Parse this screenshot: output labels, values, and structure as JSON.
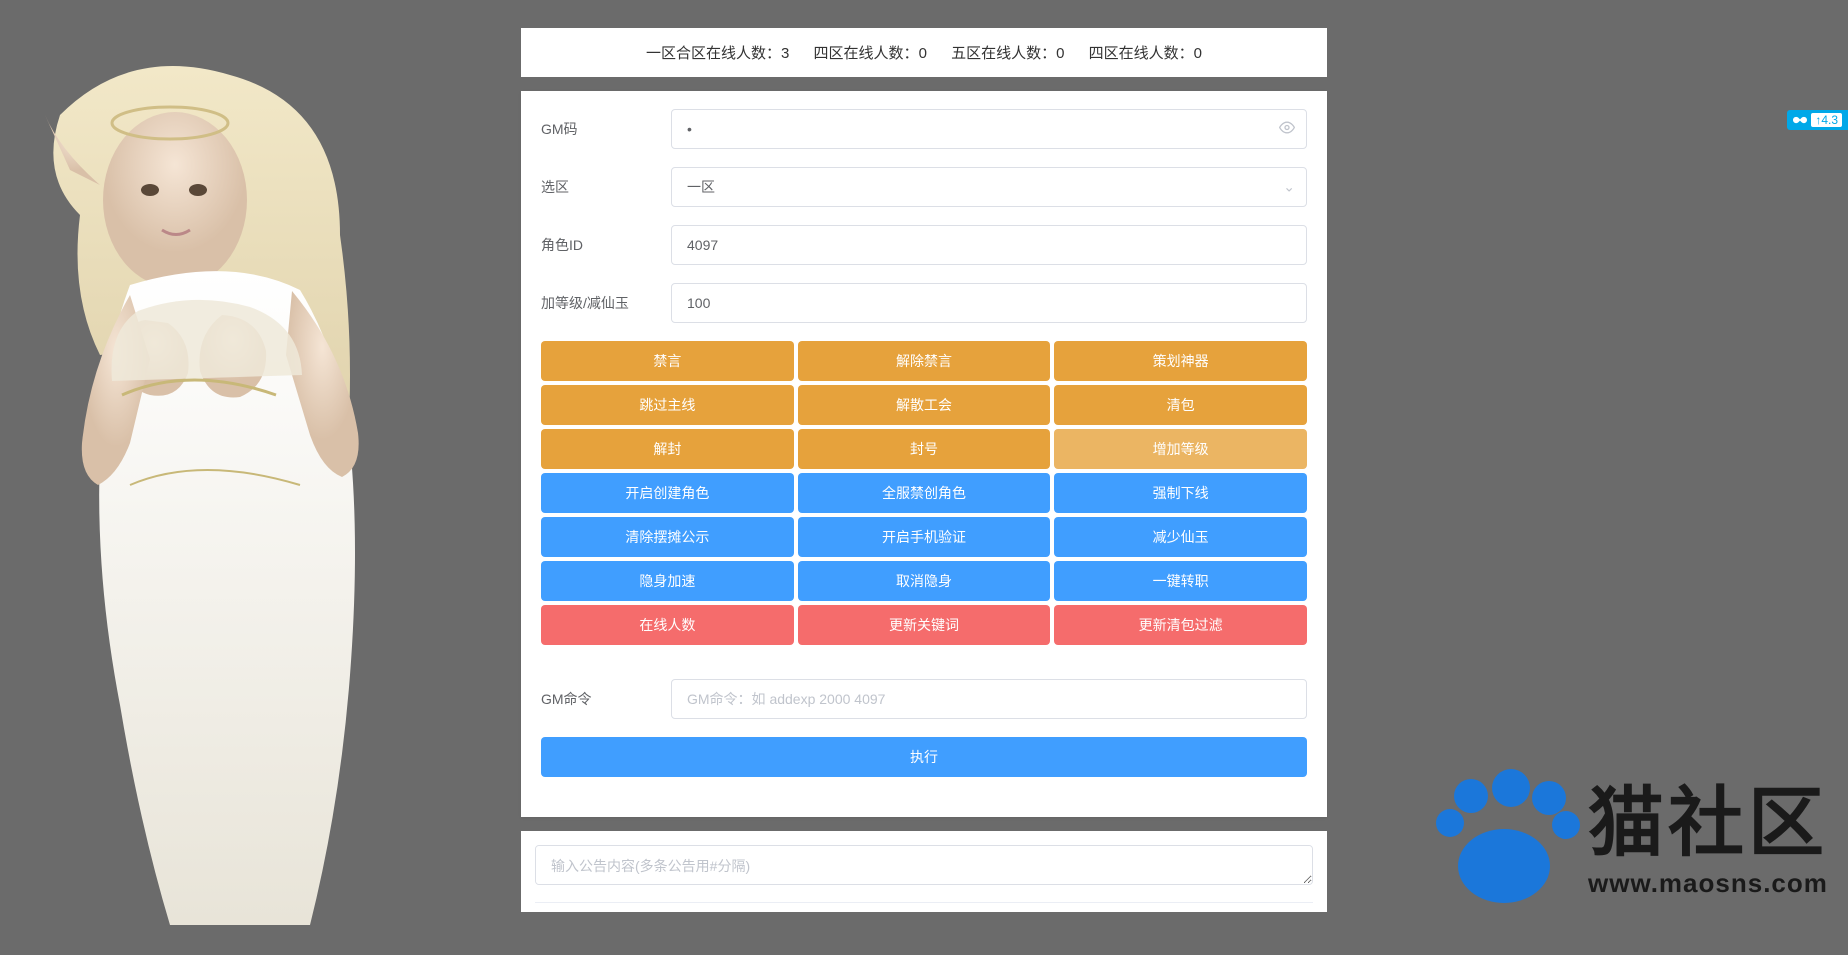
{
  "status": [
    {
      "label": "一区合区在线人数：",
      "value": "3"
    },
    {
      "label": "四区在线人数：",
      "value": "0"
    },
    {
      "label": "五区在线人数：",
      "value": "0"
    },
    {
      "label": "四区在线人数：",
      "value": "0"
    }
  ],
  "form": {
    "gm_code_label": "GM码",
    "gm_code_value": "•",
    "zone_label": "选区",
    "zone_value": "一区",
    "role_id_label": "角色ID",
    "role_id_value": "4097",
    "level_label": "加等级/减仙玉",
    "level_value": "100",
    "gm_cmd_label": "GM命令",
    "gm_cmd_placeholder": "GM命令：如 addexp 2000 4097",
    "execute_label": "执行",
    "bulletin_placeholder": "输入公告内容(多条公告用#分隔)"
  },
  "button_rows": [
    {
      "style": "warning",
      "items": [
        "禁言",
        "解除禁言",
        "策划神器"
      ]
    },
    {
      "style": "warning",
      "items": [
        "跳过主线",
        "解散工会",
        "清包"
      ]
    },
    {
      "style": "warning",
      "items": [
        "解封",
        "封号",
        "增加等级"
      ],
      "light_last": true
    },
    {
      "style": "primary",
      "items": [
        "开启创建角色",
        "全服禁创角色",
        "强制下线"
      ]
    },
    {
      "style": "primary",
      "items": [
        "清除摆摊公示",
        "开启手机验证",
        "减少仙玉"
      ]
    },
    {
      "style": "primary",
      "items": [
        "隐身加速",
        "取消隐身",
        "一键转职"
      ]
    },
    {
      "style": "danger",
      "items": [
        "在线人数",
        "更新关键词",
        "更新清包过滤"
      ]
    }
  ],
  "watermark": {
    "title": "猫社区",
    "url": "www.maosns.com"
  },
  "float_badge": "4.3"
}
